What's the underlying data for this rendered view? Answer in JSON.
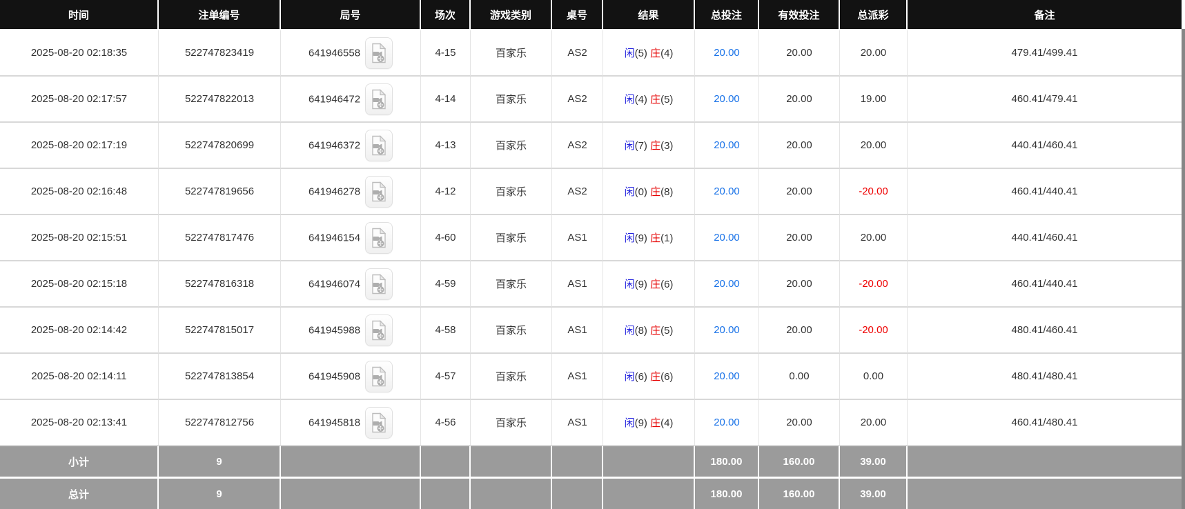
{
  "labels": {
    "player": "闲",
    "banker": "庄"
  },
  "colors": {
    "header_bg": "#121212",
    "summary_bg": "#9b9b9b",
    "player_blue": "#2222dd",
    "banker_red": "#e60000",
    "link_blue": "#1a73e8",
    "neg_red": "#ee0000"
  },
  "table": {
    "columns": [
      "时间",
      "注单编号",
      "局号",
      "场次",
      "游戏类别",
      "桌号",
      "结果",
      "总投注",
      "有效投注",
      "总派彩",
      "备注"
    ],
    "rows": [
      {
        "time": "2025-08-20 02:18:35",
        "bet_id": "522747823419",
        "round_id": "641946558",
        "session": "4-15",
        "game": "百家乐",
        "table_no": "AS2",
        "player_points": "5",
        "banker_points": "4",
        "total_bet": "20.00",
        "valid_bet": "20.00",
        "payout": "20.00",
        "remark": "479.41/499.41"
      },
      {
        "time": "2025-08-20 02:17:57",
        "bet_id": "522747822013",
        "round_id": "641946472",
        "session": "4-14",
        "game": "百家乐",
        "table_no": "AS2",
        "player_points": "4",
        "banker_points": "5",
        "total_bet": "20.00",
        "valid_bet": "20.00",
        "payout": "19.00",
        "remark": "460.41/479.41"
      },
      {
        "time": "2025-08-20 02:17:19",
        "bet_id": "522747820699",
        "round_id": "641946372",
        "session": "4-13",
        "game": "百家乐",
        "table_no": "AS2",
        "player_points": "7",
        "banker_points": "3",
        "total_bet": "20.00",
        "valid_bet": "20.00",
        "payout": "20.00",
        "remark": "440.41/460.41"
      },
      {
        "time": "2025-08-20 02:16:48",
        "bet_id": "522747819656",
        "round_id": "641946278",
        "session": "4-12",
        "game": "百家乐",
        "table_no": "AS2",
        "player_points": "0",
        "banker_points": "8",
        "total_bet": "20.00",
        "valid_bet": "20.00",
        "payout": "-20.00",
        "remark": "460.41/440.41"
      },
      {
        "time": "2025-08-20 02:15:51",
        "bet_id": "522747817476",
        "round_id": "641946154",
        "session": "4-60",
        "game": "百家乐",
        "table_no": "AS1",
        "player_points": "9",
        "banker_points": "1",
        "total_bet": "20.00",
        "valid_bet": "20.00",
        "payout": "20.00",
        "remark": "440.41/460.41"
      },
      {
        "time": "2025-08-20 02:15:18",
        "bet_id": "522747816318",
        "round_id": "641946074",
        "session": "4-59",
        "game": "百家乐",
        "table_no": "AS1",
        "player_points": "9",
        "banker_points": "6",
        "total_bet": "20.00",
        "valid_bet": "20.00",
        "payout": "-20.00",
        "remark": "460.41/440.41"
      },
      {
        "time": "2025-08-20 02:14:42",
        "bet_id": "522747815017",
        "round_id": "641945988",
        "session": "4-58",
        "game": "百家乐",
        "table_no": "AS1",
        "player_points": "8",
        "banker_points": "5",
        "total_bet": "20.00",
        "valid_bet": "20.00",
        "payout": "-20.00",
        "remark": "480.41/460.41"
      },
      {
        "time": "2025-08-20 02:14:11",
        "bet_id": "522747813854",
        "round_id": "641945908",
        "session": "4-57",
        "game": "百家乐",
        "table_no": "AS1",
        "player_points": "6",
        "banker_points": "6",
        "total_bet": "20.00",
        "valid_bet": "0.00",
        "payout": "0.00",
        "remark": "480.41/480.41"
      },
      {
        "time": "2025-08-20 02:13:41",
        "bet_id": "522747812756",
        "round_id": "641945818",
        "session": "4-56",
        "game": "百家乐",
        "table_no": "AS1",
        "player_points": "9",
        "banker_points": "4",
        "total_bet": "20.00",
        "valid_bet": "20.00",
        "payout": "20.00",
        "remark": "460.41/480.41"
      }
    ],
    "subtotal": {
      "label": "小计",
      "count": "9",
      "total_bet": "180.00",
      "valid_bet": "160.00",
      "payout": "39.00"
    },
    "total": {
      "label": "总计",
      "count": "9",
      "total_bet": "180.00",
      "valid_bet": "160.00",
      "payout": "39.00"
    }
  }
}
